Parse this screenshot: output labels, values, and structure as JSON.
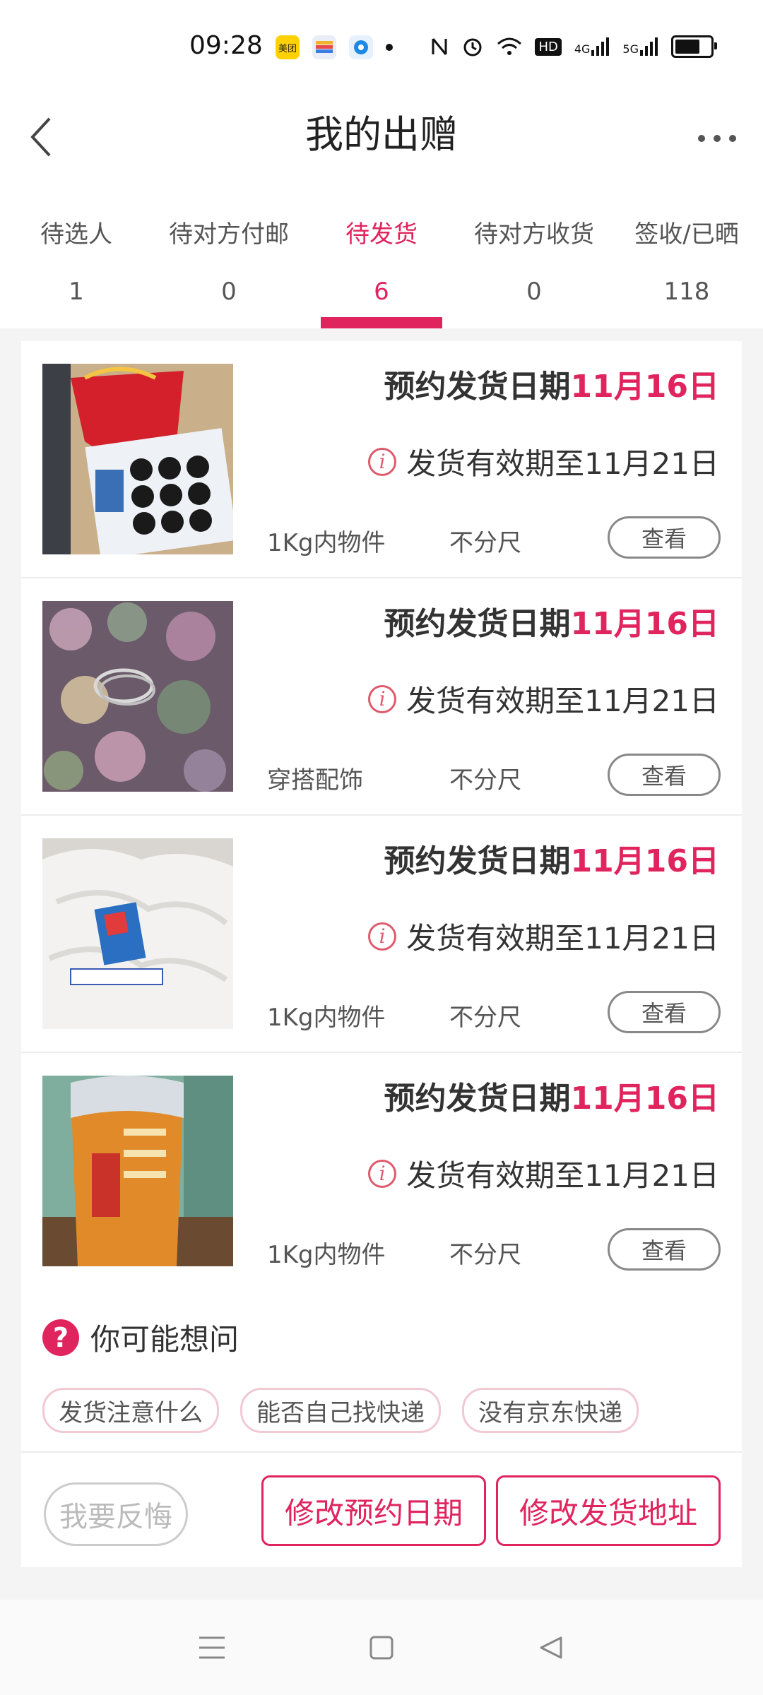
{
  "status_bar": {
    "time": "09:28",
    "icons": [
      "meituan-app-icon",
      "wallet-app-icon",
      "circle-app-icon",
      "dot-icon",
      "nfc-icon",
      "alarm-icon",
      "wifi-icon",
      "hd-icon",
      "signal-4g-icon",
      "signal-5g-icon",
      "battery-icon"
    ],
    "meituan": "美团",
    "hd": "HD",
    "net1": "4G",
    "net2": "5G"
  },
  "header": {
    "title": "我的出赠"
  },
  "tabs": [
    {
      "label": "待选人",
      "count": "1"
    },
    {
      "label": "待对方付邮",
      "count": "0"
    },
    {
      "label": "待发货",
      "count": "6",
      "active": true
    },
    {
      "label": "待对方收货",
      "count": "0"
    },
    {
      "label": "签收/已晒",
      "count": "118"
    }
  ],
  "items": [
    {
      "ship_label": "预约发货日期",
      "ship_date": "11月16日",
      "valid": "发货有效期至11月21日",
      "category": "1Kg内物件",
      "size": "不分尺",
      "view": "查看"
    },
    {
      "ship_label": "预约发货日期",
      "ship_date": "11月16日",
      "valid": "发货有效期至11月21日",
      "category": "穿搭配饰",
      "size": "不分尺",
      "view": "查看"
    },
    {
      "ship_label": "预约发货日期",
      "ship_date": "11月16日",
      "valid": "发货有效期至11月21日",
      "category": "1Kg内物件",
      "size": "不分尺",
      "view": "查看"
    },
    {
      "ship_label": "预约发货日期",
      "ship_date": "11月16日",
      "valid": "发货有效期至11月21日",
      "category": "1Kg内物件",
      "size": "不分尺",
      "view": "查看"
    }
  ],
  "faq": {
    "title": "你可能想问",
    "chips": [
      "发货注意什么",
      "能否自己找快递",
      "没有京东快递"
    ]
  },
  "actions": {
    "regret": "我要反悔",
    "change_date": "修改预约日期",
    "change_address": "修改发货地址"
  },
  "colors": {
    "accent": "#e0245e",
    "background": "#f4f4f4"
  }
}
